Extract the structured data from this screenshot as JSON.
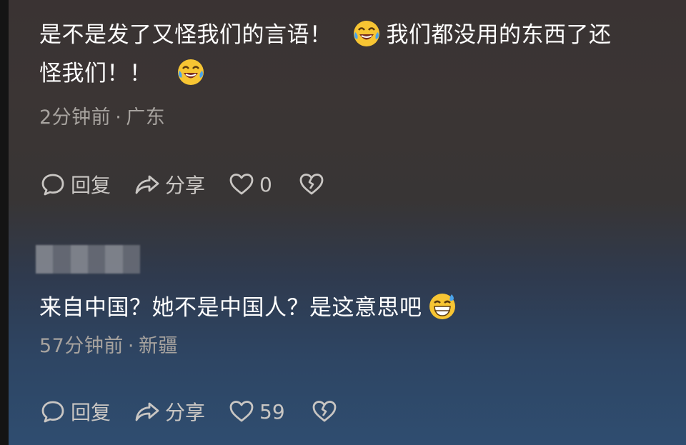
{
  "comments": [
    {
      "line1_a": "是不是发了又怪我们的言语！",
      "line1_b": "我们都没用的东西了还",
      "line2": "怪我们！！",
      "time": "2分钟前",
      "location": "广东",
      "reply_label": "回复",
      "share_label": "分享",
      "like_count": "0"
    },
    {
      "line1": "来自中国？她不是中国人？是这意思吧",
      "time": "57分钟前",
      "location": "新疆",
      "reply_label": "回复",
      "share_label": "分享",
      "like_count": "59"
    }
  ],
  "separator": "·",
  "icons": {
    "emoji_1": "laughing-crying-emoji-icon",
    "emoji_2": "grinning-sweat-emoji-icon",
    "reply": "chat-bubble-icon",
    "share": "share-arrow-icon",
    "like": "heart-icon",
    "dislike": "broken-heart-icon"
  },
  "colors": {
    "text": "#ffffff",
    "meta": "#a7a39f",
    "action": "#c9c6c3"
  }
}
